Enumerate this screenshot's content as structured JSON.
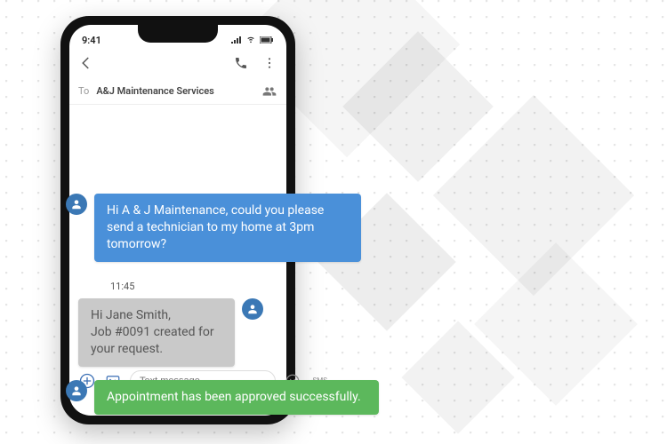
{
  "status": {
    "time": "9:41"
  },
  "header": {
    "to_label": "To",
    "contact_name": "A&J Maintenance Services"
  },
  "messages": {
    "m1": {
      "text": "Hi A & J Maintenance, could you please send a technician to my home at 3pm tomorrow?",
      "time": "11:45"
    },
    "m2": {
      "text": "Hi Jane Smith,\nJob #0091 created for your request."
    },
    "m3": {
      "text": "Appointment has been approved successfully."
    }
  },
  "composer": {
    "placeholder": "Text message",
    "send_label": "SMS"
  },
  "colors": {
    "outgoing": "#4a90d9",
    "incoming": "#c9c9c9",
    "success": "#5cb85c",
    "accent": "#3b6fb5"
  }
}
